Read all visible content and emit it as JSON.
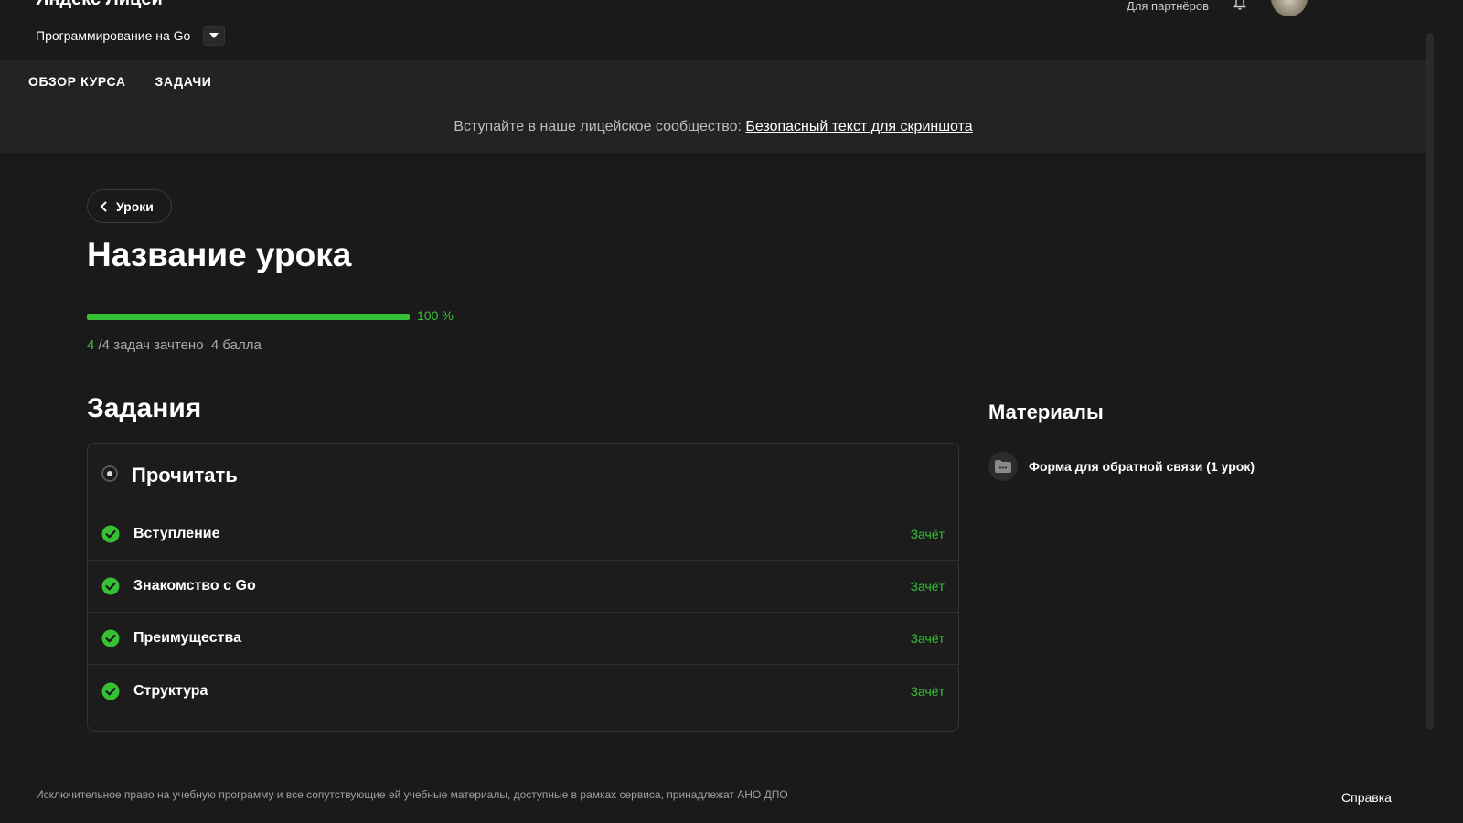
{
  "header": {
    "brand": "Яндекс Лицей",
    "course_name": "Программирование на Go",
    "nav_label": "Для партнёров",
    "icons": {
      "dropdown": "chevron-down-icon",
      "bell": "bell-icon",
      "avatar": "avatar"
    }
  },
  "tabs": [
    {
      "label": "Обзор курса"
    },
    {
      "label": "Задачи"
    }
  ],
  "banner": {
    "text": "Вступайте в наше лицейское сообщество: ",
    "link": "Безопасный текст для скриншота"
  },
  "back_button": {
    "label": "Уроки"
  },
  "lesson": {
    "title": "Название урока"
  },
  "progress": {
    "percent": 100,
    "percent_label": "100 %",
    "done": "4",
    "total_label": "/4 задач зачтено",
    "points": "4 балла"
  },
  "tasks": {
    "heading": "Задания",
    "group_title": "Прочитать",
    "items": [
      {
        "name": "Вступление",
        "status": "Зачёт"
      },
      {
        "name": "Знакомство с Go",
        "status": "Зачёт"
      },
      {
        "name": "Преимущества",
        "status": "Зачёт"
      },
      {
        "name": "Структура",
        "status": "Зачёт"
      }
    ]
  },
  "materials": {
    "heading": "Материалы",
    "items": [
      {
        "name": "Форма для обратной связи (1 урок)"
      }
    ]
  },
  "footer": {
    "text": "Исключительное право на учебную программу и все сопутствующие ей учебные материалы, доступные в рамках сервиса, принадлежат АНО ДПО",
    "help": "Справка"
  },
  "colors": {
    "background": "#1a1a1a",
    "band": "#232323",
    "accent_green": "#34c134",
    "text": "#ffffff",
    "muted": "#a8a8a8"
  }
}
